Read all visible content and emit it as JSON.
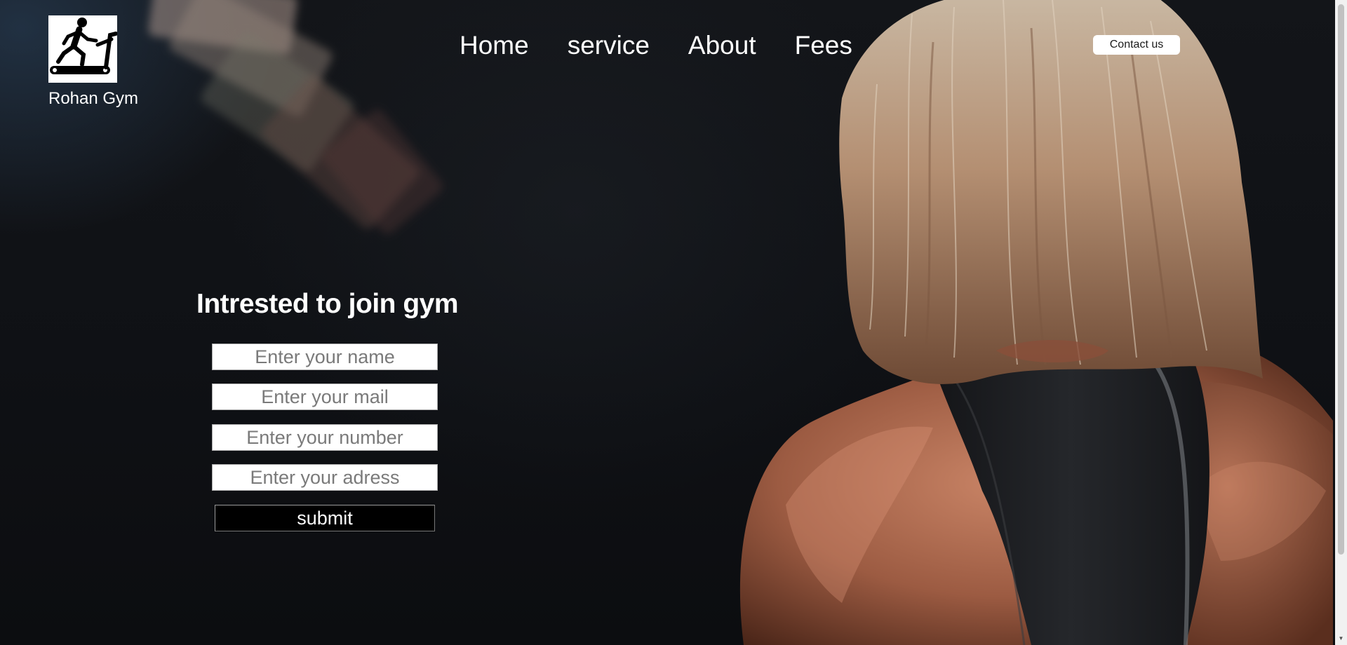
{
  "brand": {
    "name": "Rohan Gym",
    "logo_icon": "treadmill-runner-icon"
  },
  "nav": {
    "links": [
      "Home",
      "service",
      "About",
      "Fees"
    ],
    "contact_label": "Contact us"
  },
  "form": {
    "title": "Intrested to join gym",
    "fields": [
      {
        "placeholder": "Enter your name",
        "value": ""
      },
      {
        "placeholder": "Enter your mail",
        "value": ""
      },
      {
        "placeholder": "Enter your number",
        "value": ""
      },
      {
        "placeholder": "Enter your adress",
        "value": ""
      }
    ],
    "submit_label": "submit"
  },
  "colors": {
    "background": "#101216",
    "text": "#ffffff",
    "button_dark": "#000000",
    "button_light": "#ffffff"
  }
}
